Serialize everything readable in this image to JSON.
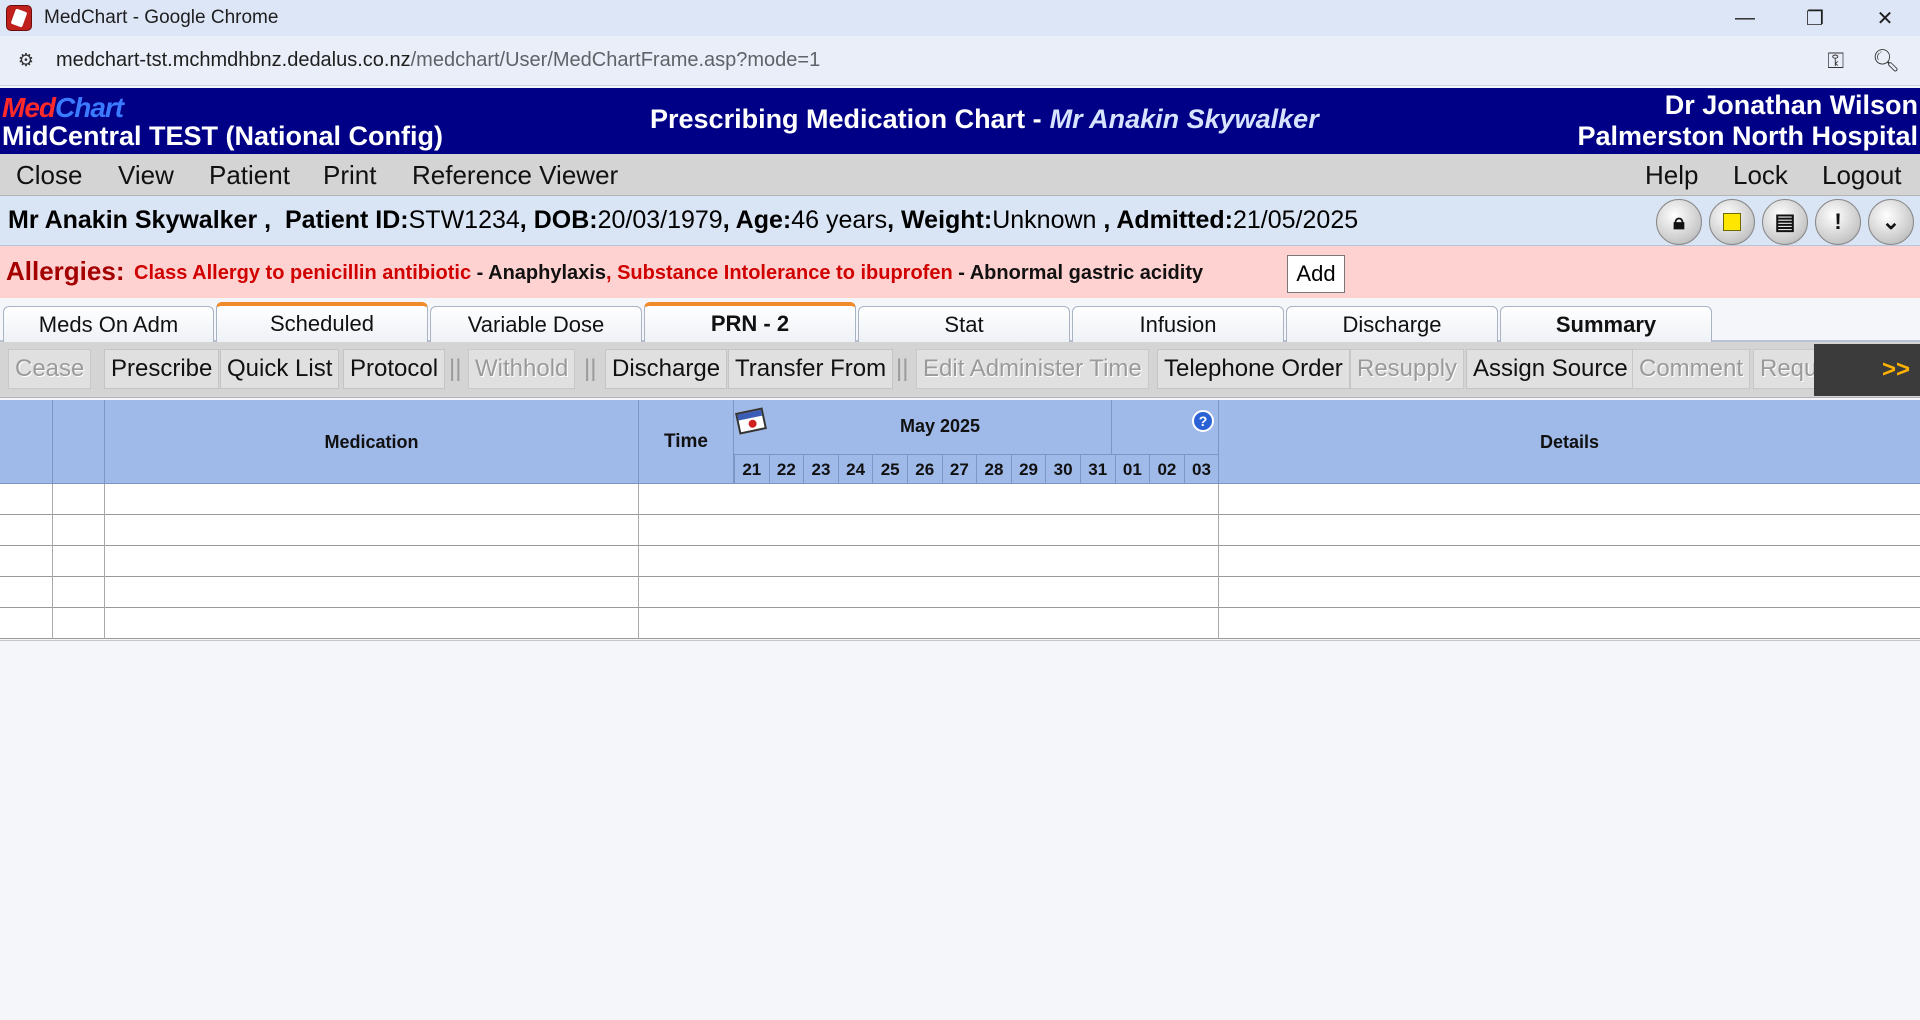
{
  "browser": {
    "window_title": "MedChart - Google Chrome",
    "url_host": "medchart-tst.mchmdhbnz.dedalus.co.nz",
    "url_path": "/medchart/User/MedChartFrame.asp?mode=1",
    "controls": {
      "minimize": "—",
      "restore": "❐",
      "close": "✕"
    },
    "site_info_icon": "tune-icon",
    "key_icon": "key-icon",
    "zoom_icon": "zoom-icon"
  },
  "header": {
    "logo_med": "Med",
    "logo_chart": "Chart",
    "site_name": "MidCentral TEST (National Config)",
    "chart_title": "Prescribing Medication Chart -",
    "patient_name": "Mr Anakin Skywalker",
    "doctor": "Dr Jonathan Wilson",
    "hospital": "Palmerston North Hospital",
    "colors": {
      "background": "#000087",
      "logo_med": "#ff2a2a",
      "logo_chart": "#3a7bff"
    }
  },
  "menu": {
    "left": [
      "Close",
      "View",
      "Patient",
      "Print",
      "Reference Viewer"
    ],
    "right": [
      "Help",
      "Lock",
      "Logout"
    ]
  },
  "patient": {
    "name": "Mr Anakin Skywalker",
    "sep1": " ,",
    "id_label": "Patient ID:",
    "id_value": "STW1234",
    "dob_label": ", DOB:",
    "dob_value": "20/03/1979",
    "age_label": ", Age:",
    "age_value": "46 years",
    "weight_label": ", Weight:",
    "weight_value": "Unknown",
    "admitted_label": " , Admitted:",
    "admitted_value": "21/05/2025",
    "icons": [
      "lock-person-icon",
      "stop-icon",
      "notes-icon",
      "alert-icon",
      "expand-icon"
    ]
  },
  "allergies": {
    "label": "Allergies:",
    "item1_allergen": "Class Allergy to penicillin antibiotic",
    "item1_reaction": " - Anaphylaxis",
    "item2_allergen": ", Substance Intolerance to ibuprofen",
    "item2_reaction": " - Abnormal gastric acidity",
    "add_label": "Add",
    "colors": {
      "background": "#ffd2d2",
      "allergen": "#d00000"
    }
  },
  "tabs": [
    "Meds On Adm",
    "Scheduled",
    "Variable Dose",
    "PRN - 2",
    "Stat",
    "Infusion",
    "Discharge",
    "Summary"
  ],
  "toolbar": {
    "cease": "Cease",
    "prescribe": "Prescribe",
    "quick_list": "Quick List",
    "protocol": "Protocol",
    "withhold": "Withhold",
    "discharge": "Discharge",
    "transfer_from": "Transfer From",
    "edit_administer_time": "Edit Administer Time",
    "telephone_order": "Telephone Order",
    "resupply": "Resupply",
    "assign_source": "Assign Source",
    "comment": "Comment",
    "request_resupply": "Request Resupply",
    "more": ">>",
    "separator": "||"
  },
  "grid": {
    "headers": {
      "medication": "Medication",
      "time": "Time",
      "details": "Details"
    },
    "month": "May 2025",
    "days": [
      "21",
      "22",
      "23",
      "24",
      "25",
      "26",
      "27",
      "28",
      "29",
      "30",
      "31",
      "01",
      "02",
      "03"
    ],
    "calendar_icon": "calendar-icon",
    "help_icon": "help-icon",
    "help_glyph": "?",
    "empty_rows": 5,
    "colors": {
      "header": "#9fb9e9"
    }
  }
}
